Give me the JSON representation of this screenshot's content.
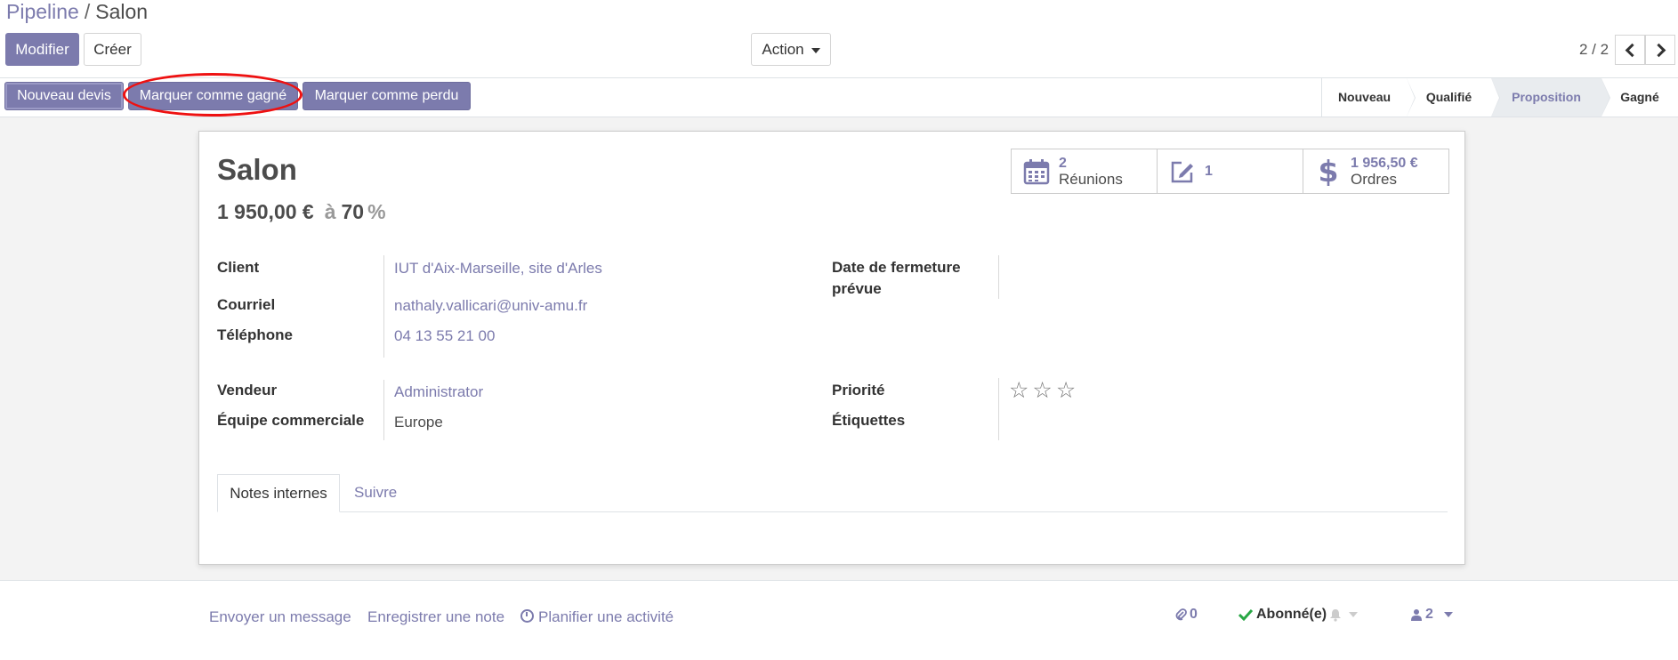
{
  "breadcrumb": {
    "parent": "Pipeline",
    "separator": "/",
    "current": "Salon"
  },
  "toolbar": {
    "edit_label": "Modifier",
    "create_label": "Créer",
    "action_label": "Action"
  },
  "pager": {
    "value": "2 / 2"
  },
  "statusbar": {
    "buttons": [
      "Nouveau devis",
      "Marquer comme gagné",
      "Marquer comme perdu"
    ],
    "stages": [
      "Nouveau",
      "Qualifié",
      "Proposition",
      "Gagné"
    ],
    "current_stage": "Proposition"
  },
  "record": {
    "title": "Salon",
    "expected_revenue": "1 950,00 €",
    "at_label": "à",
    "probability": "70",
    "percent": "%"
  },
  "smart_buttons": [
    {
      "value": "2",
      "label": "Réunions",
      "icon": "calendar-icon"
    },
    {
      "value": "1",
      "label": "",
      "icon": "edit-icon"
    },
    {
      "value": "1 956,50 €",
      "label": "Ordres",
      "icon": "dollar-icon"
    }
  ],
  "fields": {
    "client": {
      "label": "Client",
      "value": "IUT d'Aix-Marseille, site d'Arles"
    },
    "email": {
      "label": "Courriel",
      "value": "nathaly.vallicari@univ-amu.fr"
    },
    "phone": {
      "label": "Téléphone",
      "value": "04 13 55 21 00"
    },
    "closing_date": {
      "label_line1": "Date de fermeture",
      "label_line2": "prévue",
      "value": ""
    },
    "salesperson": {
      "label": "Vendeur",
      "value": "Administrator"
    },
    "team": {
      "label": "Équipe commerciale",
      "value": "Europe"
    },
    "priority": {
      "label": "Priorité",
      "stars": 3,
      "selected": 0
    },
    "tags": {
      "label": "Étiquettes",
      "value": ""
    }
  },
  "tabs": [
    "Notes internes",
    "Suivre"
  ],
  "chatter": {
    "send_message": "Envoyer un message",
    "log_note": "Enregistrer une note",
    "schedule_activity": "Planifier une activité",
    "attachments_count": "0",
    "follow_status": "Abonné(e)",
    "followers_count": "2"
  },
  "colors": {
    "brand": "#7c7bad",
    "highlight": "#ee1111"
  }
}
